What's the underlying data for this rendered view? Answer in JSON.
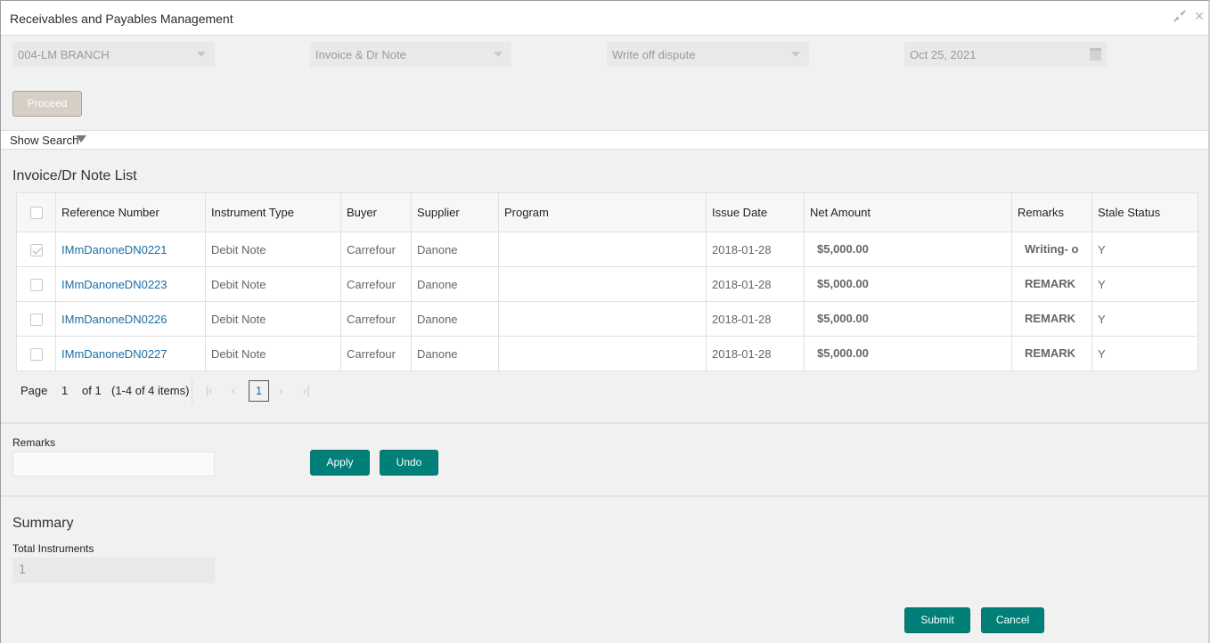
{
  "window": {
    "title": "Receivables and Payables Management",
    "restore_icon": "compress-arrows-icon",
    "close_icon": "close-icon"
  },
  "filters": {
    "branch": "004-LM BRANCH",
    "instrument_type": "Invoice & Dr Note",
    "action": "Write off dispute",
    "date": "Oct 25, 2021"
  },
  "buttons": {
    "proceed": "Proceed",
    "apply": "Apply",
    "undo": "Undo",
    "submit": "Submit",
    "cancel": "Cancel"
  },
  "show_search": "Show Search",
  "list": {
    "title": "Invoice/Dr Note List",
    "columns": [
      "Reference Number",
      "Instrument Type",
      "Buyer",
      "Supplier",
      "Program",
      "Issue Date",
      "Net Amount",
      "Remarks",
      "Stale Status"
    ],
    "rows": [
      {
        "checked": true,
        "reference": "IMmDanoneDN0221",
        "instrument_type": "Debit Note",
        "buyer": "Carrefour",
        "supplier": "Danone",
        "program": "",
        "issue_date": "2018-01-28",
        "net_amount": "$5,000.00",
        "remarks": "Writing- o",
        "stale_status": "Y"
      },
      {
        "checked": false,
        "reference": "IMmDanoneDN0223",
        "instrument_type": "Debit Note",
        "buyer": "Carrefour",
        "supplier": "Danone",
        "program": "",
        "issue_date": "2018-01-28",
        "net_amount": "$5,000.00",
        "remarks": "REMARK",
        "stale_status": "Y"
      },
      {
        "checked": false,
        "reference": "IMmDanoneDN0226",
        "instrument_type": "Debit Note",
        "buyer": "Carrefour",
        "supplier": "Danone",
        "program": "",
        "issue_date": "2018-01-28",
        "net_amount": "$5,000.00",
        "remarks": "REMARK",
        "stale_status": "Y"
      },
      {
        "checked": false,
        "reference": "IMmDanoneDN0227",
        "instrument_type": "Debit Note",
        "buyer": "Carrefour",
        "supplier": "Danone",
        "program": "",
        "issue_date": "2018-01-28",
        "net_amount": "$5,000.00",
        "remarks": "REMARK",
        "stale_status": "Y"
      }
    ]
  },
  "pagination": {
    "page_label": "Page",
    "current_page": "1",
    "of_label": "of 1",
    "items_label": "(1-4 of 4 items)",
    "first_icon": "K",
    "prev_icon": "<",
    "next_icon": ">",
    "last_icon": "K"
  },
  "remarks": {
    "label": "Remarks",
    "value": ""
  },
  "summary": {
    "title": "Summary",
    "total_instruments_label": "Total Instruments",
    "total_instruments_value": "1"
  }
}
